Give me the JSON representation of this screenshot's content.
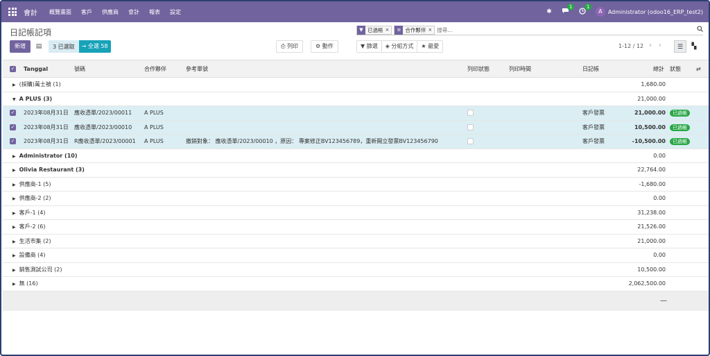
{
  "navbar": {
    "app_name": "會計",
    "menu": [
      "概覽畫面",
      "客戶",
      "供應商",
      "會計",
      "報表",
      "設定"
    ],
    "chat_count": "1",
    "activity_count": "1",
    "avatar_letter": "A",
    "user": "Administrator (odoo16_ERP_test2)"
  },
  "control": {
    "breadcrumb": "日記帳記項",
    "facets": [
      {
        "icon": "funnel-icon",
        "label": "已過帳"
      },
      {
        "icon": "layers-icon",
        "label": "合作夥伴"
      }
    ],
    "search_placeholder": "搜尋...",
    "new_label": "新增",
    "selected_label": "3 已選取",
    "select_all_label": "→ 全選 58",
    "print_label": "列印",
    "action_label": "動作",
    "filter_label": "篩選",
    "groupby_label": "分組方式",
    "favorite_label": "最愛",
    "pager": "1-12 / 12"
  },
  "table": {
    "headers": {
      "date": "Tanggal",
      "number": "號碼",
      "partner": "合作夥伴",
      "ref": "參考單號",
      "print_status": "列印狀態",
      "print_time": "列印時間",
      "journal": "日記帳",
      "total": "總計",
      "status": "狀態"
    },
    "groups": [
      {
        "label": "(採購)萬士禎 (1)",
        "total": "1,680.00",
        "open": false,
        "bold": false
      },
      {
        "label": "A PLUS (3)",
        "total": "21,000.00",
        "open": true,
        "bold": true
      },
      {
        "label": "Administrator (10)",
        "total": "0.00",
        "open": false,
        "bold": true
      },
      {
        "label": "Olivia Restaurant (3)",
        "total": "22,764.00",
        "open": false,
        "bold": true
      },
      {
        "label": "供應商-1 (5)",
        "total": "-1,680.00",
        "open": false,
        "bold": false
      },
      {
        "label": "供應商-2 (2)",
        "total": "0.00",
        "open": false,
        "bold": false
      },
      {
        "label": "客戶-1 (4)",
        "total": "31,238.00",
        "open": false,
        "bold": false
      },
      {
        "label": "客戶-2 (6)",
        "total": "21,526.00",
        "open": false,
        "bold": false
      },
      {
        "label": "生活市集 (2)",
        "total": "21,000.00",
        "open": false,
        "bold": false
      },
      {
        "label": "設備商 (4)",
        "total": "0.00",
        "open": false,
        "bold": false
      },
      {
        "label": "銷售測試公司 (2)",
        "total": "10,500.00",
        "open": false,
        "bold": false
      },
      {
        "label": "無 (16)",
        "total": "2,062,500.00",
        "open": false,
        "bold": false
      }
    ],
    "records": [
      {
        "date": "2023年08月31日",
        "number": "應收憑單/2023/00011",
        "partner": "A PLUS",
        "ref": "",
        "journal": "客戶發票",
        "total": "21,000.00",
        "status": "已過帳"
      },
      {
        "date": "2023年08月31日",
        "number": "應收憑單/2023/00010",
        "partner": "A PLUS",
        "ref": "",
        "journal": "客戶發票",
        "total": "10,500.00",
        "status": "已過帳"
      },
      {
        "date": "2023年08月31日",
        "number": "R應收憑單/2023/00001",
        "partner": "A PLUS",
        "ref": "撤銷對象： 應收憑單/2023/00010 ，原因： 專案修正BV123456789，重新開立發票BV123456790",
        "journal": "客戶發票",
        "total": "-10,500.00",
        "status": "已過帳"
      }
    ],
    "footer_total": "—"
  }
}
